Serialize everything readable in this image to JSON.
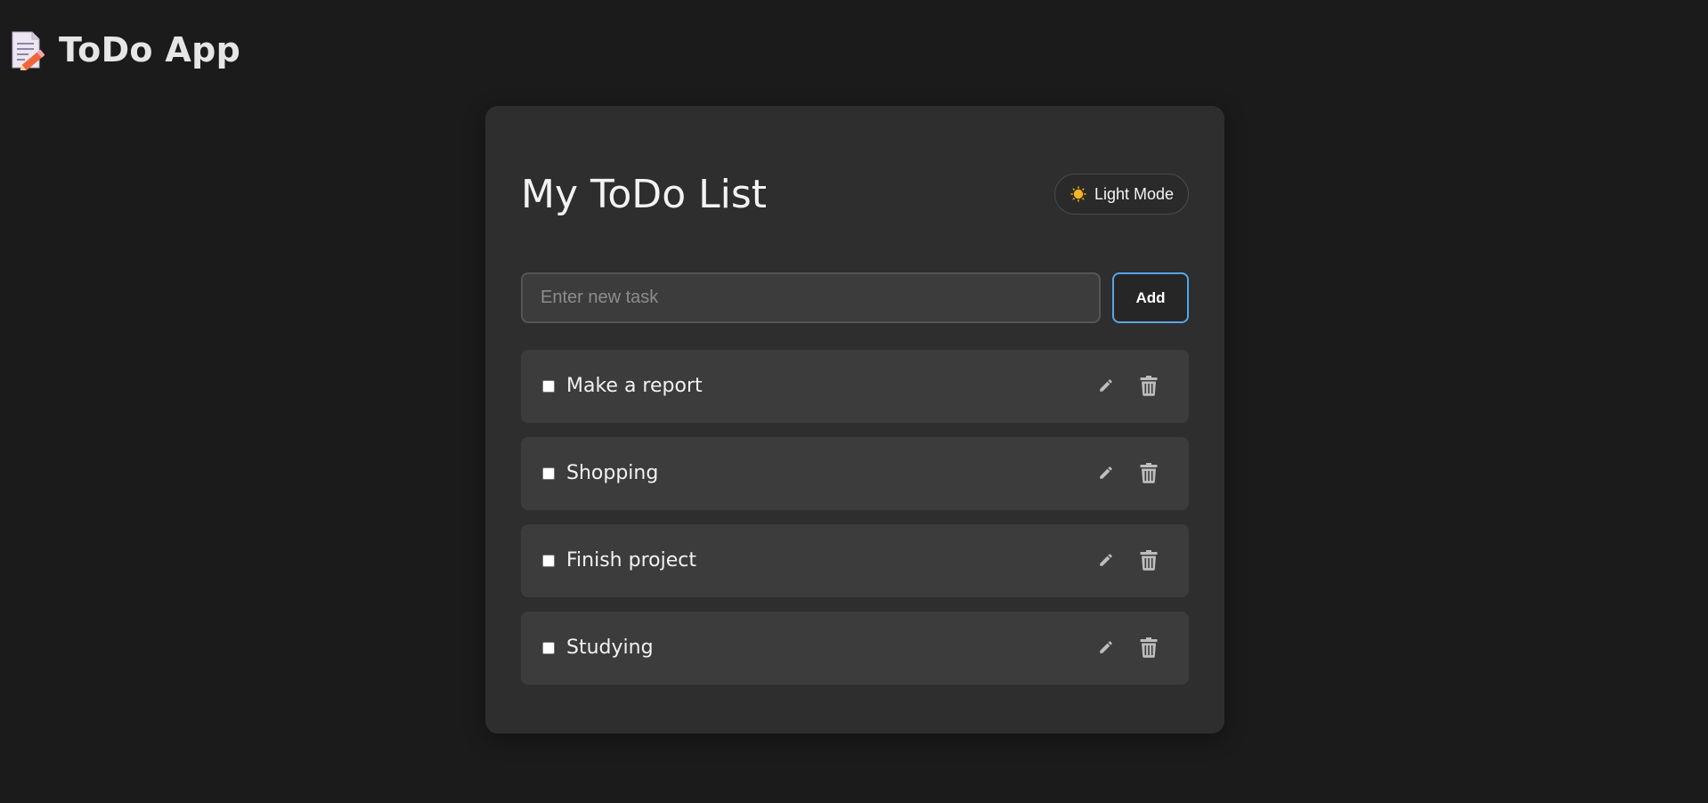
{
  "header": {
    "app_title": "ToDo App",
    "logo_icon": "memo-pencil-icon"
  },
  "card": {
    "title": "My ToDo List",
    "theme_toggle": {
      "label": "Light Mode",
      "icon": "sun-icon"
    },
    "new_task": {
      "placeholder": "Enter new task",
      "value": ""
    },
    "add_label": "Add"
  },
  "tasks": [
    {
      "text": "Make a report",
      "done": false
    },
    {
      "text": "Shopping",
      "done": false
    },
    {
      "text": "Finish project",
      "done": false
    },
    {
      "text": "Studying",
      "done": false
    }
  ],
  "icons": {
    "edit": "pencil-icon",
    "delete": "trash-icon"
  },
  "colors": {
    "background": "#1b1b1b",
    "card": "#2e2e2e",
    "task_row": "#3c3c3c",
    "accent": "#58a6e6",
    "icon": "#bdbdbd"
  }
}
